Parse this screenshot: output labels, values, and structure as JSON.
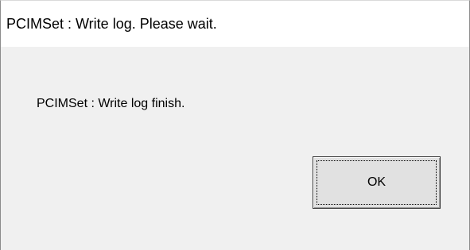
{
  "window": {
    "title": "PCIMSet : Write log. Please wait."
  },
  "dialog": {
    "message": "PCIMSet : Write log finish.",
    "ok_label": "OK"
  }
}
